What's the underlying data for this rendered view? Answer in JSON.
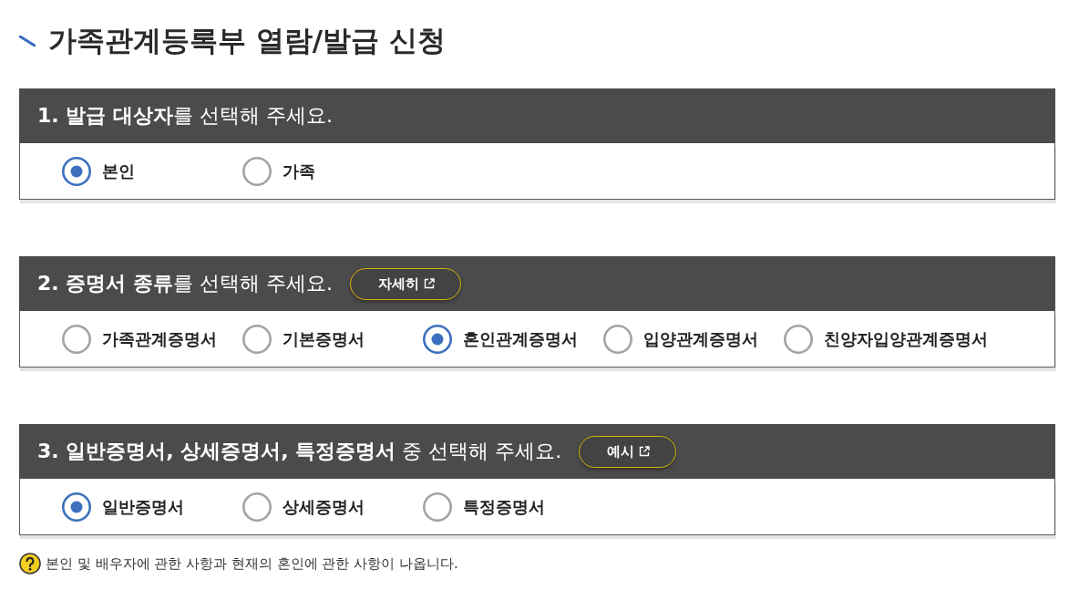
{
  "page_title": "가족관계등록부 열람/발급 신청",
  "sections": [
    {
      "heading": "**1. 발급 대상자**를 선택해 주세요.",
      "options": [
        {
          "label": "본인",
          "selected": true
        },
        {
          "label": "가족",
          "selected": false
        }
      ]
    },
    {
      "heading": "**2. 증명서 종류**를 선택해 주세요.",
      "button": "자세히",
      "options": [
        {
          "label": "가족관계증명서",
          "selected": false
        },
        {
          "label": "기본증명서",
          "selected": false
        },
        {
          "label": "혼인관계증명서",
          "selected": true
        },
        {
          "label": "입양관계증명서",
          "selected": false
        },
        {
          "label": "친양자입양관계증명서",
          "selected": false
        }
      ]
    },
    {
      "heading": "**3. 일반증명서, 상세증명서, 특정증명서** 중 선택해 주세요.",
      "button": "예시",
      "options": [
        {
          "label": "일반증명서",
          "selected": true
        },
        {
          "label": "상세증명서",
          "selected": false
        },
        {
          "label": "특정증명서",
          "selected": false
        }
      ]
    }
  ],
  "note": "본인 및 배우자에 관한 사항과 현재의 혼인에 관한 사항이 나옵니다."
}
